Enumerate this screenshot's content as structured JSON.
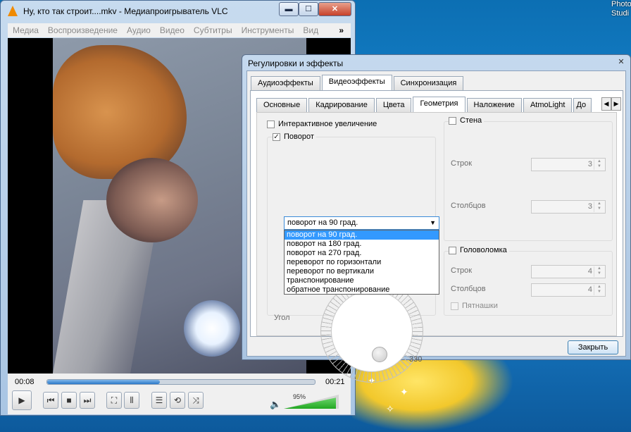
{
  "desktop": {
    "label": "Photo Studi"
  },
  "vlc": {
    "title": "Ну, кто так строит....mkv - Медиапроигрыватель VLC",
    "window_buttons": {
      "minimize": "▬",
      "maximize": "☐",
      "close": "✕"
    },
    "menu": [
      "Медиа",
      "Воспроизведение",
      "Аудио",
      "Видео",
      "Субтитры",
      "Инструменты",
      "Вид"
    ],
    "menu_more": "»",
    "time_elapsed": "00:08",
    "time_total": "00:21",
    "seek_progress": 0.42,
    "volume_label": "95%",
    "volume_level": 0.95,
    "buttons": {
      "play": "▶",
      "prev": "⏮",
      "stop": "■",
      "next": "⏭",
      "fullscreen": "⛶",
      "ext": "⫴",
      "playlist": "☰",
      "loop": "⟲",
      "shuffle": "⤨"
    }
  },
  "dialog": {
    "title": "Регулировки и эффекты",
    "close_glyph": "✕",
    "top_tabs": [
      "Аудиоэффекты",
      "Видеоэффекты",
      "Синхронизация"
    ],
    "top_active": 1,
    "sub_tabs": [
      "Основные",
      "Кадрирование",
      "Цвета",
      "Геометрия",
      "Наложение",
      "AtmoLight",
      "До"
    ],
    "sub_active": 3,
    "interactive_zoom": {
      "label": "Интерактивное увеличение",
      "checked": false
    },
    "rotate": {
      "label": "Поворот",
      "checked": true,
      "selected": "поворот на 90 град.",
      "options": [
        "поворот на 90 град.",
        "поворот на 180 град.",
        "поворот на 270 град.",
        "переворот по горизонтали",
        "переворот по вертикали",
        "транспонирование",
        "обратное транспонирование"
      ],
      "angle_label": "Угол",
      "angle_value": "330"
    },
    "wall": {
      "label": "Стена",
      "rows_label": "Строк",
      "rows_value": "3",
      "cols_label": "Столбцов",
      "cols_value": "3"
    },
    "puzzle": {
      "label": "Головоломка",
      "rows_label": "Строк",
      "rows_value": "4",
      "cols_label": "Столбцов",
      "cols_value": "4",
      "fifteen_label": "Пятнашки"
    },
    "close_button": "Закрыть"
  }
}
